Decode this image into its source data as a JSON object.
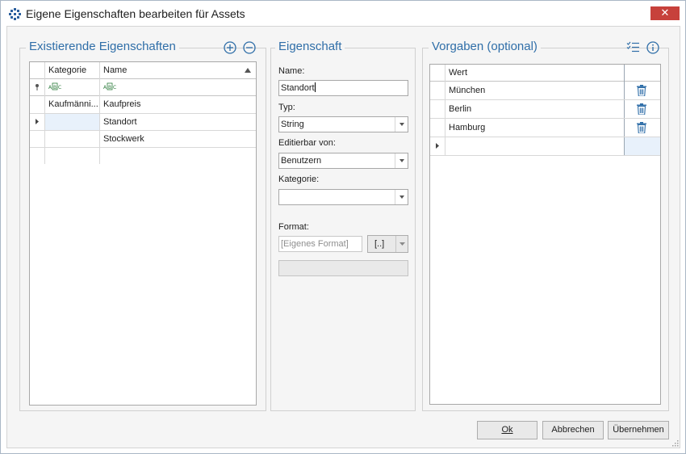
{
  "window": {
    "title": "Eigene Eigenschaften bearbeiten für Assets",
    "close_glyph": "✕",
    "accent_color": "#2f6ea8"
  },
  "existing": {
    "title": "Existierende Eigenschaften",
    "add_icon": "plus-circle-icon",
    "remove_icon": "minus-circle-icon",
    "columns": [
      "Kategorie",
      "Name"
    ],
    "filter_icons": [
      "filter-pin-icon",
      "abc-filter-icon",
      "abc-filter-icon"
    ],
    "rows": [
      {
        "kategorie": "Kaufmänni...",
        "name": "Kaufpreis",
        "selected": false
      },
      {
        "kategorie": "",
        "name": "Standort",
        "selected": true
      },
      {
        "kategorie": "",
        "name": "Stockwerk",
        "selected": false
      }
    ]
  },
  "property": {
    "title": "Eigenschaft",
    "name_label": "Name:",
    "name_value": "Standort",
    "typ_label": "Typ:",
    "typ_value": "String",
    "editable_label": "Editierbar von:",
    "editable_value": "Benutzern",
    "kategorie_label": "Kategorie:",
    "kategorie_value": "",
    "format_label": "Format:",
    "format_placeholder": "[Eigenes Format]",
    "format_button": "[..]"
  },
  "defaults": {
    "title": "Vorgaben (optional)",
    "checklist_icon": "checklist-icon",
    "info_icon": "info-icon",
    "column": "Wert",
    "rows": [
      "München",
      "Berlin",
      "Hamburg"
    ]
  },
  "footer": {
    "ok_label": "Ok",
    "cancel_label": "Abbrechen",
    "apply_label": "Übernehmen"
  }
}
